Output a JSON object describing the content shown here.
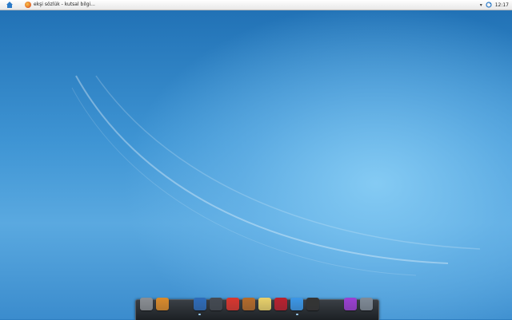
{
  "topbar": {
    "home_icon": "home-icon",
    "task": {
      "icon": "firefox-icon",
      "title": "ekşi sözlük - kutsal bilgi..."
    },
    "tray": {
      "menu_arrow": "▾",
      "sync_icon": "sync-icon",
      "clock": "12:17"
    }
  },
  "dock": {
    "items": [
      {
        "name": "finder-icon",
        "color": "#8a8e93"
      },
      {
        "name": "notes-app-icon",
        "color": "#d98a2b"
      },
      {
        "name": "firefox-icon",
        "color": "#2d6bb8"
      },
      {
        "name": "apps-icon",
        "color": "#444a52"
      },
      {
        "name": "chrome-icon",
        "color": "#d8362e"
      },
      {
        "name": "monkey-icon",
        "color": "#b36a2a"
      },
      {
        "name": "pen-icon",
        "color": "#e8d06a"
      },
      {
        "name": "mouse-icon",
        "color": "#b8202e"
      },
      {
        "name": "chat-icon",
        "color": "#3b96e6"
      },
      {
        "name": "clapper-icon",
        "color": "#333333"
      },
      {
        "name": "purple-app-icon",
        "color": "#9b3fd2"
      },
      {
        "name": "trash-icon",
        "color": "#7f8a96"
      }
    ]
  }
}
